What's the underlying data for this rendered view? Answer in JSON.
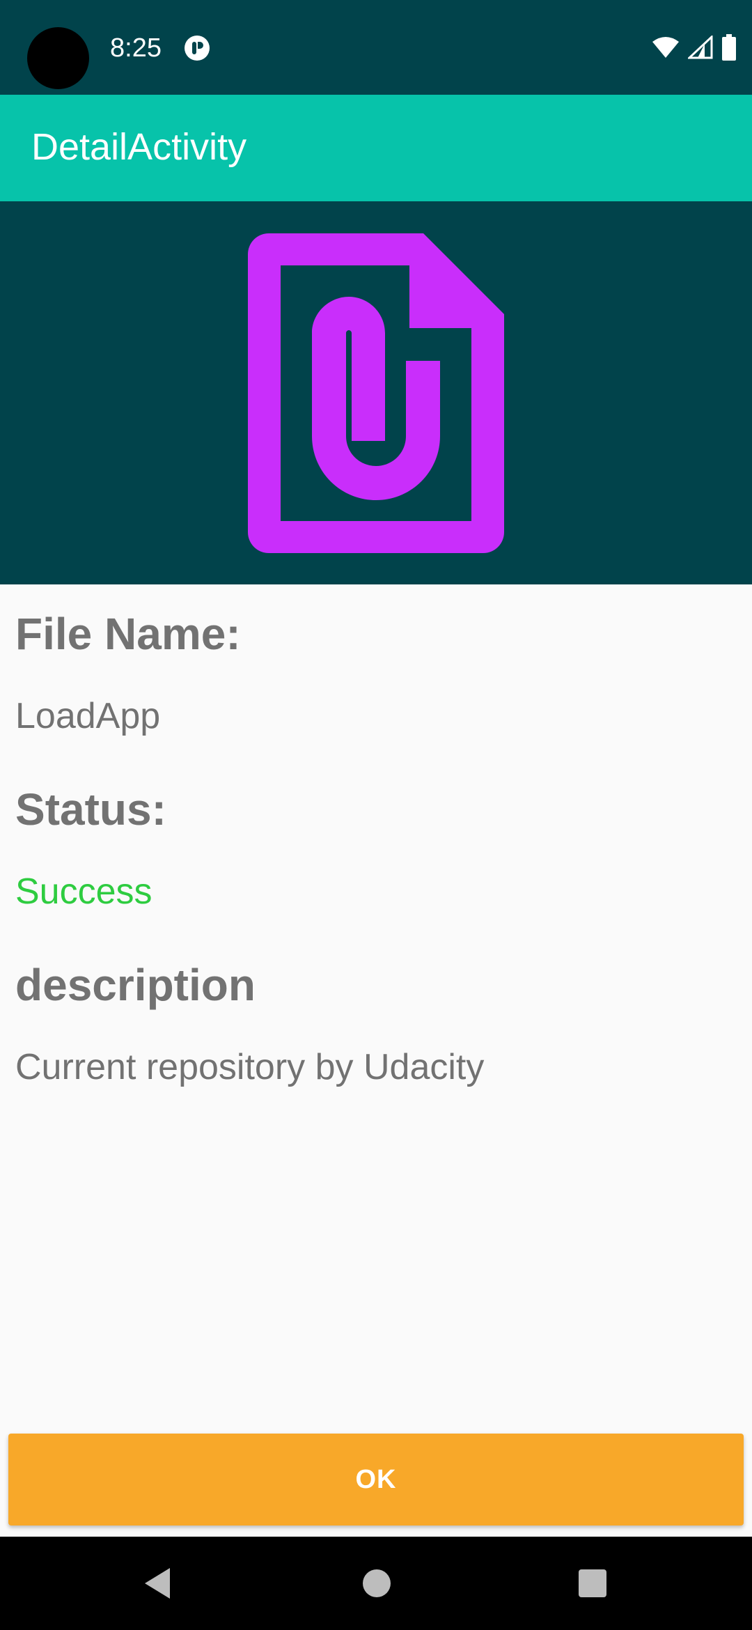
{
  "status_bar": {
    "time": "8:25",
    "icons": [
      "app-notification-icon",
      "wifi-icon",
      "cellular-signal-icon",
      "battery-icon"
    ],
    "background": "#01434B"
  },
  "app_bar": {
    "title": "DetailActivity",
    "background": "#07C3AA"
  },
  "hero": {
    "icon": "file-attachment-icon",
    "icon_color": "#C92EFB",
    "background": "#01434B"
  },
  "details": {
    "file_name_label": "File Name:",
    "file_name_value": "LoadApp",
    "status_label": "Status:",
    "status_value": "Success",
    "status_color": "#2ECC40",
    "description_label": "description",
    "description_value": "Current repository by Udacity"
  },
  "actions": {
    "ok_label": "OK",
    "ok_color": "#F8A829"
  },
  "nav_bar": {
    "buttons": [
      "back-icon",
      "home-icon",
      "recents-icon"
    ]
  }
}
